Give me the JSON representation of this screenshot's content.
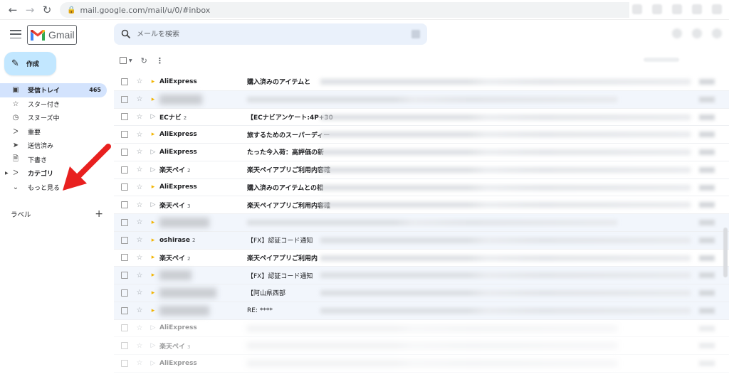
{
  "browser": {
    "url": "mail.google.com/mail/u/0/#inbox"
  },
  "header": {
    "logo_text": "Gmail",
    "search_placeholder": "メールを検索"
  },
  "compose": {
    "label": "作成"
  },
  "sidebar": {
    "items": [
      {
        "label": "受信トレイ",
        "icon": "inbox-icon",
        "count": "465",
        "active": true
      },
      {
        "label": "スター付き",
        "icon": "star-icon",
        "count": ""
      },
      {
        "label": "スヌーズ中",
        "icon": "clock-icon",
        "count": ""
      },
      {
        "label": "重要",
        "icon": "important-icon",
        "count": ""
      },
      {
        "label": "送信済み",
        "icon": "send-icon",
        "count": ""
      },
      {
        "label": "下書き",
        "icon": "draft-icon",
        "count": ""
      },
      {
        "label": "カテゴリ",
        "icon": "label-icon",
        "count": ""
      },
      {
        "label": "もっと見る",
        "icon": "chevron-down-icon",
        "count": ""
      }
    ],
    "labels_heading": "ラベル"
  },
  "emails": [
    {
      "sender": "AliExpress",
      "count": "",
      "subject": "購入済みのアイテムと",
      "important": true,
      "read": false
    },
    {
      "sender": "",
      "count": "",
      "subject": "",
      "important": true,
      "read": true
    },
    {
      "sender": "ECナビ",
      "count": "2",
      "subject": "【ECナビアンケート:4P+30",
      "important": false,
      "read": false
    },
    {
      "sender": "AliExpress",
      "count": "",
      "subject": "旅するためのスーパーディー",
      "important": true,
      "read": false
    },
    {
      "sender": "AliExpress",
      "count": "",
      "subject": "たった今入荷：高評価の新",
      "important": false,
      "read": false
    },
    {
      "sender": "楽天ペイ",
      "count": "2",
      "subject": "楽天ペイアプリご利用内容確",
      "important": false,
      "read": false
    },
    {
      "sender": "AliExpress",
      "count": "",
      "subject": "購入済みのアイテムとの相",
      "important": true,
      "read": false
    },
    {
      "sender": "楽天ペイ",
      "count": "3",
      "subject": "楽天ペイアプリご利用内容確",
      "important": false,
      "read": false
    },
    {
      "sender": "",
      "count": "",
      "subject": "",
      "important": true,
      "read": true
    },
    {
      "sender": "oshirase",
      "count": "2",
      "subject": "【FX】認証コード通知",
      "important": true,
      "read": true
    },
    {
      "sender": "楽天ペイ",
      "count": "2",
      "subject": "楽天ペイアプリご利用内",
      "important": true,
      "read": false
    },
    {
      "sender": "",
      "count": "",
      "subject": "【FX】認証コード通知",
      "important": true,
      "read": true
    },
    {
      "sender": "",
      "count": "",
      "subject": "【阿山県西部",
      "important": true,
      "read": true
    },
    {
      "sender": "",
      "count": "",
      "subject": "RE: ****",
      "important": true,
      "read": true
    },
    {
      "sender": "AliExpress",
      "count": "",
      "subject": "",
      "important": false,
      "read": false
    },
    {
      "sender": "楽天ペイ",
      "count": "3",
      "subject": "",
      "important": false,
      "read": false
    },
    {
      "sender": "AliExpress",
      "count": "",
      "subject": "",
      "important": false,
      "read": false
    }
  ]
}
